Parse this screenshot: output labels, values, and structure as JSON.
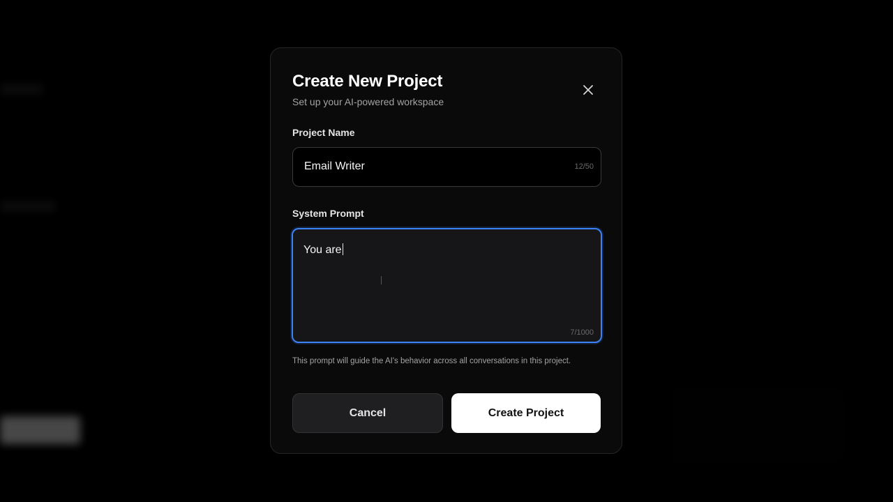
{
  "modal": {
    "title": "Create New Project",
    "subtitle": "Set up your AI-powered workspace",
    "close_icon": "close-icon"
  },
  "fields": {
    "project_name": {
      "label": "Project Name",
      "value": "Email Writer",
      "counter": "12/50"
    },
    "system_prompt": {
      "label": "System Prompt",
      "value": "You are",
      "counter": "7/1000",
      "hint": "This prompt will guide the AI's behavior across all conversations in this project."
    }
  },
  "actions": {
    "cancel_label": "Cancel",
    "create_label": "Create Project"
  },
  "colors": {
    "focus_border": "#3b82f6",
    "primary_button_bg": "#ffffff",
    "secondary_button_bg": "#1f1f21",
    "modal_bg": "#0a0a0a"
  }
}
